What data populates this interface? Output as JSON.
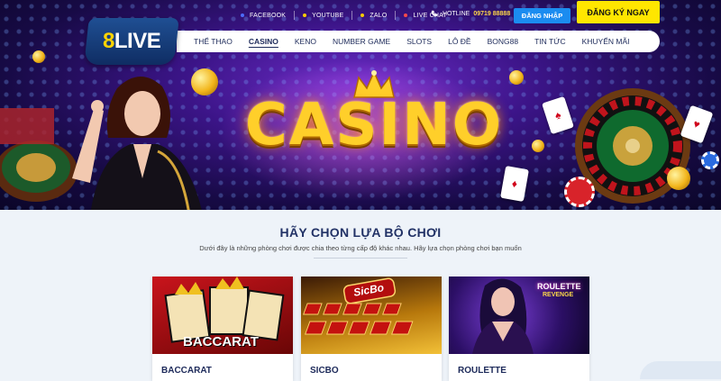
{
  "brand": {
    "logo_number": "8",
    "logo_text": "LIVE"
  },
  "topbar": {
    "social": [
      {
        "label": "FACEBOOK",
        "dot": "#4d6cff"
      },
      {
        "label": "YOUTUBE",
        "dot": "#ffcc00"
      },
      {
        "label": "ZALO",
        "dot": "#ffcc00"
      },
      {
        "label": "LIVE CHAT",
        "dot": "#ff4a4a"
      }
    ],
    "hotline_label": "HOTLINE",
    "hotline_number": "09719 88888",
    "login_label": "ĐĂNG NHẬP",
    "register_label": "ĐĂNG KÝ NGAY"
  },
  "nav": {
    "items": [
      {
        "label": "THỂ THAO",
        "active": false
      },
      {
        "label": "CASINO",
        "active": true
      },
      {
        "label": "KENO",
        "active": false
      },
      {
        "label": "NUMBER GAME",
        "active": false
      },
      {
        "label": "SLOTS",
        "active": false
      },
      {
        "label": "LÔ ĐỀ",
        "active": false
      },
      {
        "label": "BONG88",
        "active": false
      },
      {
        "label": "TIN TỨC",
        "active": false
      },
      {
        "label": "KHUYẾN MÃI",
        "active": false
      }
    ]
  },
  "hero": {
    "title": "CASINO"
  },
  "section": {
    "heading": "HÃY CHỌN LỰA BỘ CHƠI",
    "subtitle": "Dưới đây là những phòng chơi được chia theo từng cấp độ khác nhau. Hãy lựa chọn phòng chơi bạn muốn"
  },
  "games": [
    {
      "name": "BACCARAT",
      "thumb_text": "BACCARAT"
    },
    {
      "name": "SICBO",
      "thumb_text": "SicBo"
    },
    {
      "name": "ROULETTE",
      "thumb_text": "ROULETTE",
      "thumb_subtext": "REVENGE"
    }
  ],
  "colors": {
    "accent_blue": "#1b8cf0",
    "register_yellow": "#ffe600",
    "navy_text": "#1d2a5a"
  }
}
